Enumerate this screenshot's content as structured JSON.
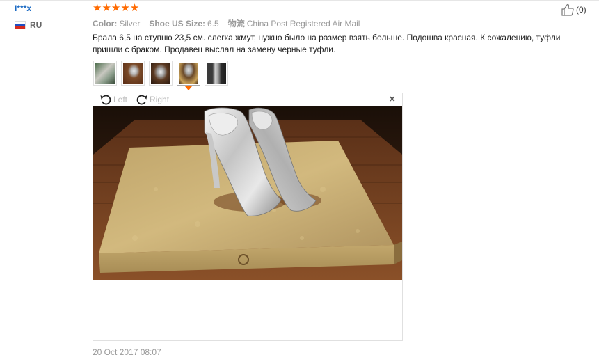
{
  "user": {
    "name": "I***x",
    "country": "RU"
  },
  "helpful": {
    "count": "(0)"
  },
  "rating": {
    "stars": 5
  },
  "attributes": [
    {
      "label": "Color:",
      "value": "Silver"
    },
    {
      "label": "Shoe US Size:",
      "value": "6.5"
    },
    {
      "label": "物流",
      "value": "China Post Registered Air Mail"
    }
  ],
  "review": {
    "text": "Брала 6,5 на ступню 23,5 см. слегка жмут, нужно было на размер взять больше. Подошва красная. К сожалению, туфли пришли с браком. Продавец выслал на замену черные туфли."
  },
  "viewer": {
    "rotate_left": "Left",
    "rotate_right": "Right",
    "close": "×"
  },
  "date": "20 Oct 2017 08:07",
  "colors": {
    "accent": "#ff6a00",
    "username": "#1c6bc4"
  }
}
